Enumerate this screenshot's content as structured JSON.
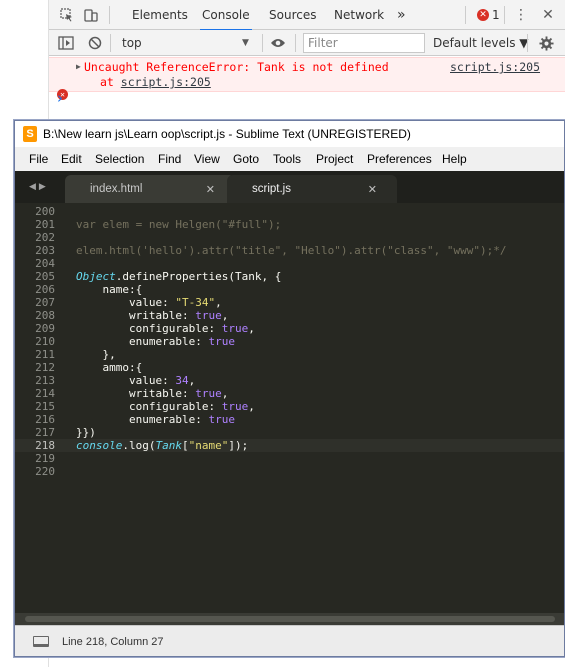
{
  "devtools": {
    "tabs": [
      "Elements",
      "Console",
      "Sources",
      "Network"
    ],
    "active_tab": "Console",
    "more_tabs": "»",
    "error_count": "1",
    "close": "✕",
    "toolbar": {
      "context": "top",
      "filter_placeholder": "Filter",
      "levels": "Default levels ▼"
    },
    "error": {
      "message": "Uncaught ReferenceError: Tank is not defined",
      "at_prefix": "at ",
      "at_location": "script.js:205",
      "source_link": "script.js:205"
    },
    "prompt": "›"
  },
  "sublime": {
    "title": "B:\\New learn js\\Learn oop\\script.js - Sublime Text (UNREGISTERED)",
    "menu": [
      "File",
      "Edit",
      "Selection",
      "Find",
      "View",
      "Goto",
      "Tools",
      "Project",
      "Preferences",
      "Help"
    ],
    "tabs": [
      {
        "label": "index.html",
        "close": "✕"
      },
      {
        "label": "script.js",
        "close": "✕"
      }
    ],
    "current_line": "218",
    "lines": [
      {
        "n": "200",
        "parts": [
          {
            "t": "",
            "c": ""
          }
        ]
      },
      {
        "n": "201",
        "parts": [
          {
            "t": "var elem = new Helgen(\"#full\");",
            "c": "cmt"
          }
        ]
      },
      {
        "n": "202",
        "parts": [
          {
            "t": "",
            "c": ""
          }
        ]
      },
      {
        "n": "203",
        "parts": [
          {
            "t": "elem.html('hello').attr(\"title\", \"Hello\").attr(\"class\", \"www\");*/",
            "c": "cmt"
          }
        ]
      },
      {
        "n": "204",
        "parts": [
          {
            "t": "",
            "c": ""
          }
        ]
      },
      {
        "n": "205",
        "parts": [
          {
            "t": "Object",
            "c": "obj"
          },
          {
            "t": ".defineProperties(Tank, {",
            "c": ""
          }
        ]
      },
      {
        "n": "206",
        "parts": [
          {
            "t": "    name:{",
            "c": ""
          }
        ]
      },
      {
        "n": "207",
        "parts": [
          {
            "t": "        value: ",
            "c": ""
          },
          {
            "t": "\"T-34\"",
            "c": "str"
          },
          {
            "t": ",",
            "c": ""
          }
        ]
      },
      {
        "n": "208",
        "parts": [
          {
            "t": "        writable: ",
            "c": ""
          },
          {
            "t": "true",
            "c": "bool"
          },
          {
            "t": ",",
            "c": ""
          }
        ]
      },
      {
        "n": "209",
        "parts": [
          {
            "t": "        configurable: ",
            "c": ""
          },
          {
            "t": "true",
            "c": "bool"
          },
          {
            "t": ",",
            "c": ""
          }
        ]
      },
      {
        "n": "210",
        "parts": [
          {
            "t": "        enumerable: ",
            "c": ""
          },
          {
            "t": "true",
            "c": "bool"
          }
        ]
      },
      {
        "n": "211",
        "parts": [
          {
            "t": "    },",
            "c": ""
          }
        ]
      },
      {
        "n": "212",
        "parts": [
          {
            "t": "    ammo:{",
            "c": ""
          }
        ]
      },
      {
        "n": "213",
        "parts": [
          {
            "t": "        value: ",
            "c": ""
          },
          {
            "t": "34",
            "c": "bool"
          },
          {
            "t": ",",
            "c": ""
          }
        ]
      },
      {
        "n": "214",
        "parts": [
          {
            "t": "        writable: ",
            "c": ""
          },
          {
            "t": "true",
            "c": "bool"
          },
          {
            "t": ",",
            "c": ""
          }
        ]
      },
      {
        "n": "215",
        "parts": [
          {
            "t": "        configurable: ",
            "c": ""
          },
          {
            "t": "true",
            "c": "bool"
          },
          {
            "t": ",",
            "c": ""
          }
        ]
      },
      {
        "n": "216",
        "parts": [
          {
            "t": "        enumerable: ",
            "c": ""
          },
          {
            "t": "true",
            "c": "bool"
          }
        ]
      },
      {
        "n": "217",
        "parts": [
          {
            "t": "}})",
            "c": ""
          }
        ]
      },
      {
        "n": "218",
        "parts": [
          {
            "t": "console",
            "c": "obj"
          },
          {
            "t": ".log(",
            "c": ""
          },
          {
            "t": "Tank",
            "c": "obj"
          },
          {
            "t": "[",
            "c": ""
          },
          {
            "t": "\"name\"",
            "c": "str"
          },
          {
            "t": "]);",
            "c": ""
          }
        ]
      },
      {
        "n": "219",
        "parts": [
          {
            "t": "",
            "c": ""
          }
        ]
      },
      {
        "n": "220",
        "parts": [
          {
            "t": "",
            "c": ""
          }
        ]
      }
    ],
    "status": "Line 218, Column 27"
  }
}
